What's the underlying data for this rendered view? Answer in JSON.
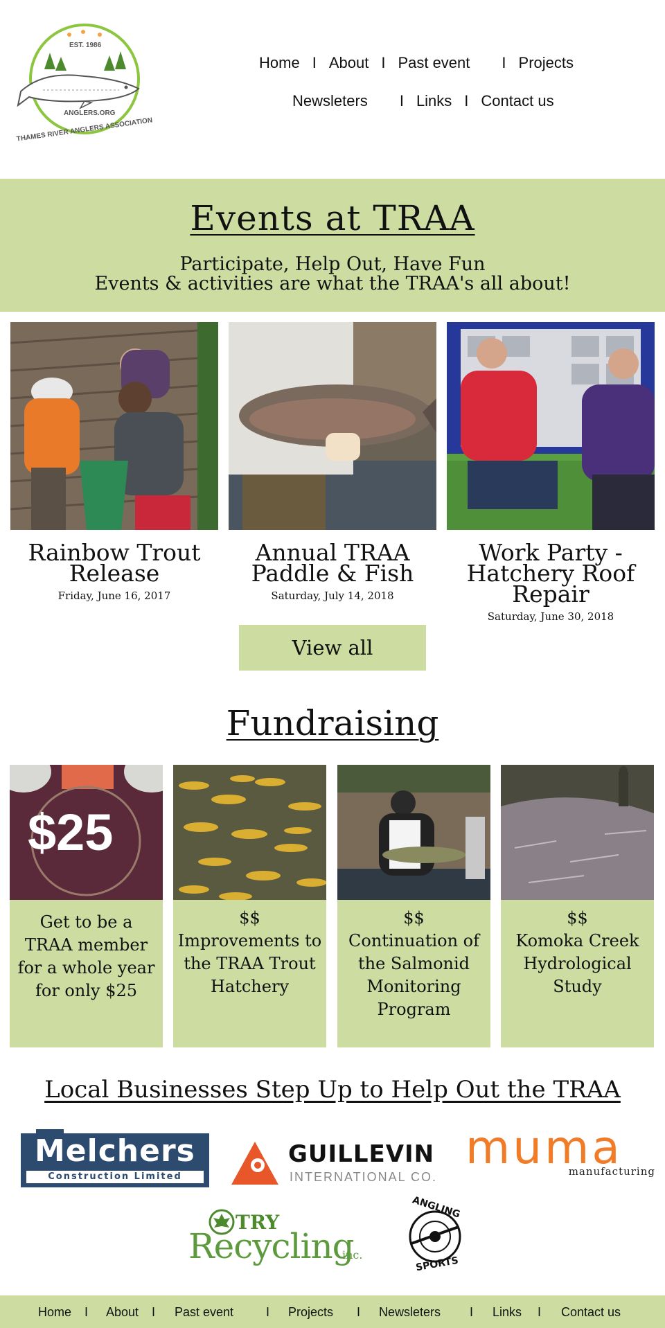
{
  "header": {
    "logo": {
      "est": "EST. 1986",
      "site": "ANGLERS.ORG",
      "name": "THAMES RIVER ANGLERS ASSOCIATION"
    },
    "nav_row1": [
      "Home",
      "About",
      "Past event",
      "Projects"
    ],
    "nav_row2": [
      "Newsleters",
      "Links",
      "Contact us"
    ]
  },
  "events": {
    "title": "Events at TRAA",
    "subtitle_line1": "Participate, Help Out, Have Fun",
    "subtitle_line2": "Events & activities are what the TRAA's all about!",
    "cards": [
      {
        "name": "Rainbow Trout Release",
        "date": "Friday, June 16, 2017"
      },
      {
        "name": "Annual TRAA Paddle & Fish",
        "date": "Saturday, July 14, 2018"
      },
      {
        "name": "Work Party - Hatchery Roof Repair",
        "date": "Saturday, June 30, 2018"
      }
    ],
    "view_all": "View all"
  },
  "fundraising": {
    "title": "Fundraising",
    "price_badge": "$25",
    "cards": [
      {
        "text": "Get to be a TRAA member for a whole year for only $25"
      },
      {
        "dollars": "$$",
        "text": "Improvements to the TRAA Trout Hatchery"
      },
      {
        "dollars": "$$",
        "text": "Continuation of the Salmonid Monitoring Program"
      },
      {
        "dollars": "$$",
        "text": "Komoka Creek Hydrological Study"
      }
    ]
  },
  "businesses": {
    "title": "Local Businesses Step Up to Help Out the TRAA",
    "melchers": {
      "name": "Melchers",
      "sub": "Construction Limited"
    },
    "guillevin": {
      "name": "GUILLEVIN",
      "sub": "INTERNATIONAL CO."
    },
    "muma": {
      "name": "muma",
      "sub": "manufacturing"
    },
    "try": {
      "name_top": "TRY",
      "name_bottom": "Recycling",
      "suffix": "inc."
    },
    "angling": {
      "top": "ANGLING",
      "bottom": "SPORTS"
    }
  },
  "footer": {
    "items": [
      "Home",
      "About",
      "Past event",
      "Projects",
      "Newsleters",
      "Links",
      "Contact us"
    ]
  },
  "colors": {
    "accent": "#cddda2",
    "logo_green": "#8cc63f",
    "guillevin_orange": "#e8572a",
    "muma_orange": "#f07c28",
    "melchers_blue": "#2d4a6f"
  }
}
